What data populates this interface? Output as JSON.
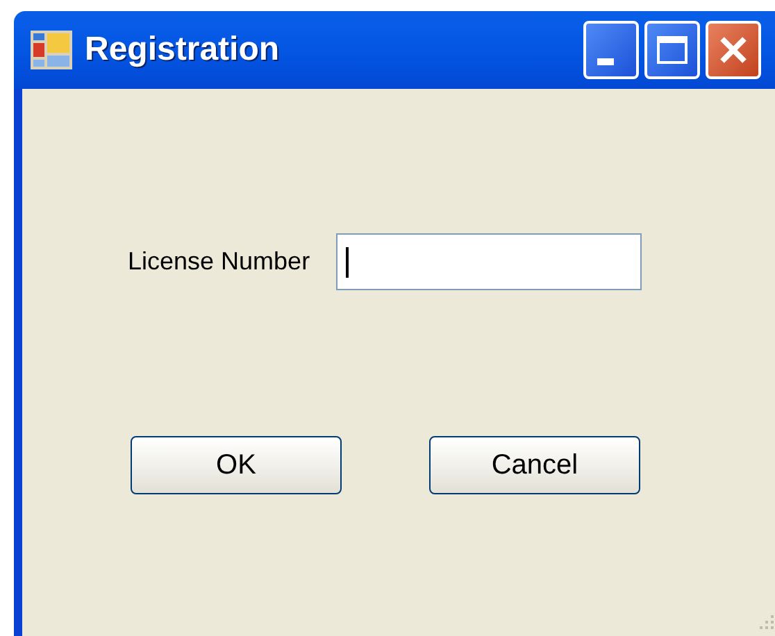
{
  "window": {
    "title": "Registration"
  },
  "field": {
    "label": "License Number",
    "focused": true
  },
  "buttons": [
    {
      "label": "OK"
    },
    {
      "label": "Cancel"
    }
  ]
}
